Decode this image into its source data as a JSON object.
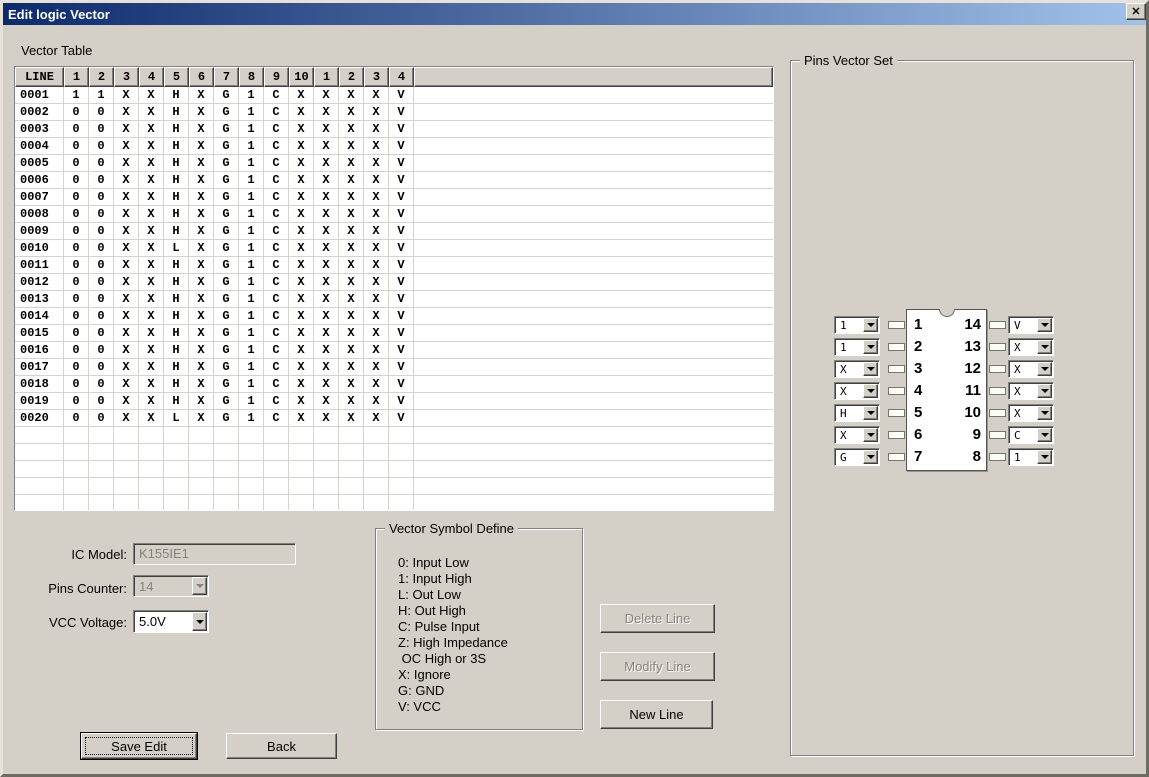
{
  "window": {
    "title": "Edit logic Vector"
  },
  "icons": {
    "close": "✕"
  },
  "colors": {
    "titlebar_gradient_start": "#0d2a6b",
    "titlebar_gradient_end": "#a2c2ea",
    "dialog_background": "#d4d0c8"
  },
  "vector_table": {
    "label": "Vector Table",
    "headers": [
      "LINE",
      "1",
      "2",
      "3",
      "4",
      "5",
      "6",
      "7",
      "8",
      "9",
      "10",
      "1",
      "2",
      "3",
      "4"
    ],
    "rows": [
      {
        "line": "0001",
        "values": [
          "1",
          "1",
          "X",
          "X",
          "H",
          "X",
          "G",
          "1",
          "C",
          "X",
          "X",
          "X",
          "X",
          "V"
        ]
      },
      {
        "line": "0002",
        "values": [
          "0",
          "0",
          "X",
          "X",
          "H",
          "X",
          "G",
          "1",
          "C",
          "X",
          "X",
          "X",
          "X",
          "V"
        ]
      },
      {
        "line": "0003",
        "values": [
          "0",
          "0",
          "X",
          "X",
          "H",
          "X",
          "G",
          "1",
          "C",
          "X",
          "X",
          "X",
          "X",
          "V"
        ]
      },
      {
        "line": "0004",
        "values": [
          "0",
          "0",
          "X",
          "X",
          "H",
          "X",
          "G",
          "1",
          "C",
          "X",
          "X",
          "X",
          "X",
          "V"
        ]
      },
      {
        "line": "0005",
        "values": [
          "0",
          "0",
          "X",
          "X",
          "H",
          "X",
          "G",
          "1",
          "C",
          "X",
          "X",
          "X",
          "X",
          "V"
        ]
      },
      {
        "line": "0006",
        "values": [
          "0",
          "0",
          "X",
          "X",
          "H",
          "X",
          "G",
          "1",
          "C",
          "X",
          "X",
          "X",
          "X",
          "V"
        ]
      },
      {
        "line": "0007",
        "values": [
          "0",
          "0",
          "X",
          "X",
          "H",
          "X",
          "G",
          "1",
          "C",
          "X",
          "X",
          "X",
          "X",
          "V"
        ]
      },
      {
        "line": "0008",
        "values": [
          "0",
          "0",
          "X",
          "X",
          "H",
          "X",
          "G",
          "1",
          "C",
          "X",
          "X",
          "X",
          "X",
          "V"
        ]
      },
      {
        "line": "0009",
        "values": [
          "0",
          "0",
          "X",
          "X",
          "H",
          "X",
          "G",
          "1",
          "C",
          "X",
          "X",
          "X",
          "X",
          "V"
        ]
      },
      {
        "line": "0010",
        "values": [
          "0",
          "0",
          "X",
          "X",
          "L",
          "X",
          "G",
          "1",
          "C",
          "X",
          "X",
          "X",
          "X",
          "V"
        ]
      },
      {
        "line": "0011",
        "values": [
          "0",
          "0",
          "X",
          "X",
          "H",
          "X",
          "G",
          "1",
          "C",
          "X",
          "X",
          "X",
          "X",
          "V"
        ]
      },
      {
        "line": "0012",
        "values": [
          "0",
          "0",
          "X",
          "X",
          "H",
          "X",
          "G",
          "1",
          "C",
          "X",
          "X",
          "X",
          "X",
          "V"
        ]
      },
      {
        "line": "0013",
        "values": [
          "0",
          "0",
          "X",
          "X",
          "H",
          "X",
          "G",
          "1",
          "C",
          "X",
          "X",
          "X",
          "X",
          "V"
        ]
      },
      {
        "line": "0014",
        "values": [
          "0",
          "0",
          "X",
          "X",
          "H",
          "X",
          "G",
          "1",
          "C",
          "X",
          "X",
          "X",
          "X",
          "V"
        ]
      },
      {
        "line": "0015",
        "values": [
          "0",
          "0",
          "X",
          "X",
          "H",
          "X",
          "G",
          "1",
          "C",
          "X",
          "X",
          "X",
          "X",
          "V"
        ]
      },
      {
        "line": "0016",
        "values": [
          "0",
          "0",
          "X",
          "X",
          "H",
          "X",
          "G",
          "1",
          "C",
          "X",
          "X",
          "X",
          "X",
          "V"
        ]
      },
      {
        "line": "0017",
        "values": [
          "0",
          "0",
          "X",
          "X",
          "H",
          "X",
          "G",
          "1",
          "C",
          "X",
          "X",
          "X",
          "X",
          "V"
        ]
      },
      {
        "line": "0018",
        "values": [
          "0",
          "0",
          "X",
          "X",
          "H",
          "X",
          "G",
          "1",
          "C",
          "X",
          "X",
          "X",
          "X",
          "V"
        ]
      },
      {
        "line": "0019",
        "values": [
          "0",
          "0",
          "X",
          "X",
          "H",
          "X",
          "G",
          "1",
          "C",
          "X",
          "X",
          "X",
          "X",
          "V"
        ]
      },
      {
        "line": "0020",
        "values": [
          "0",
          "0",
          "X",
          "X",
          "L",
          "X",
          "G",
          "1",
          "C",
          "X",
          "X",
          "X",
          "X",
          "V"
        ]
      }
    ]
  },
  "pins_vector_set": {
    "label": "Pins Vector Set",
    "left_pins": [
      {
        "pin": "1",
        "value": "1"
      },
      {
        "pin": "2",
        "value": "1"
      },
      {
        "pin": "3",
        "value": "X"
      },
      {
        "pin": "4",
        "value": "X"
      },
      {
        "pin": "5",
        "value": "H"
      },
      {
        "pin": "6",
        "value": "X"
      },
      {
        "pin": "7",
        "value": "G"
      }
    ],
    "right_pins": [
      {
        "pin": "14",
        "value": "V"
      },
      {
        "pin": "13",
        "value": "X"
      },
      {
        "pin": "12",
        "value": "X"
      },
      {
        "pin": "11",
        "value": "X"
      },
      {
        "pin": "10",
        "value": "X"
      },
      {
        "pin": "9",
        "value": "C"
      },
      {
        "pin": "8",
        "value": "1"
      }
    ]
  },
  "form": {
    "ic_model_label": "IC Model:",
    "ic_model_value": "K155IE1",
    "pins_counter_label": "Pins Counter:",
    "pins_counter_value": "14",
    "vcc_voltage_label": "VCC Voltage:",
    "vcc_voltage_value": "5.0V"
  },
  "symbol_define": {
    "label": "Vector Symbol Define",
    "lines": [
      "0: Input Low",
      "1: Input High",
      "L: Out Low",
      "H: Out High",
      "C: Pulse Input",
      "Z: High Impedance",
      " OC High or 3S",
      "X: Ignore",
      "G: GND",
      "V: VCC"
    ]
  },
  "buttons": {
    "delete_line": "Delete Line",
    "modify_line": "Modify Line",
    "new_line": "New Line",
    "save_edit": "Save Edit",
    "back": "Back"
  }
}
